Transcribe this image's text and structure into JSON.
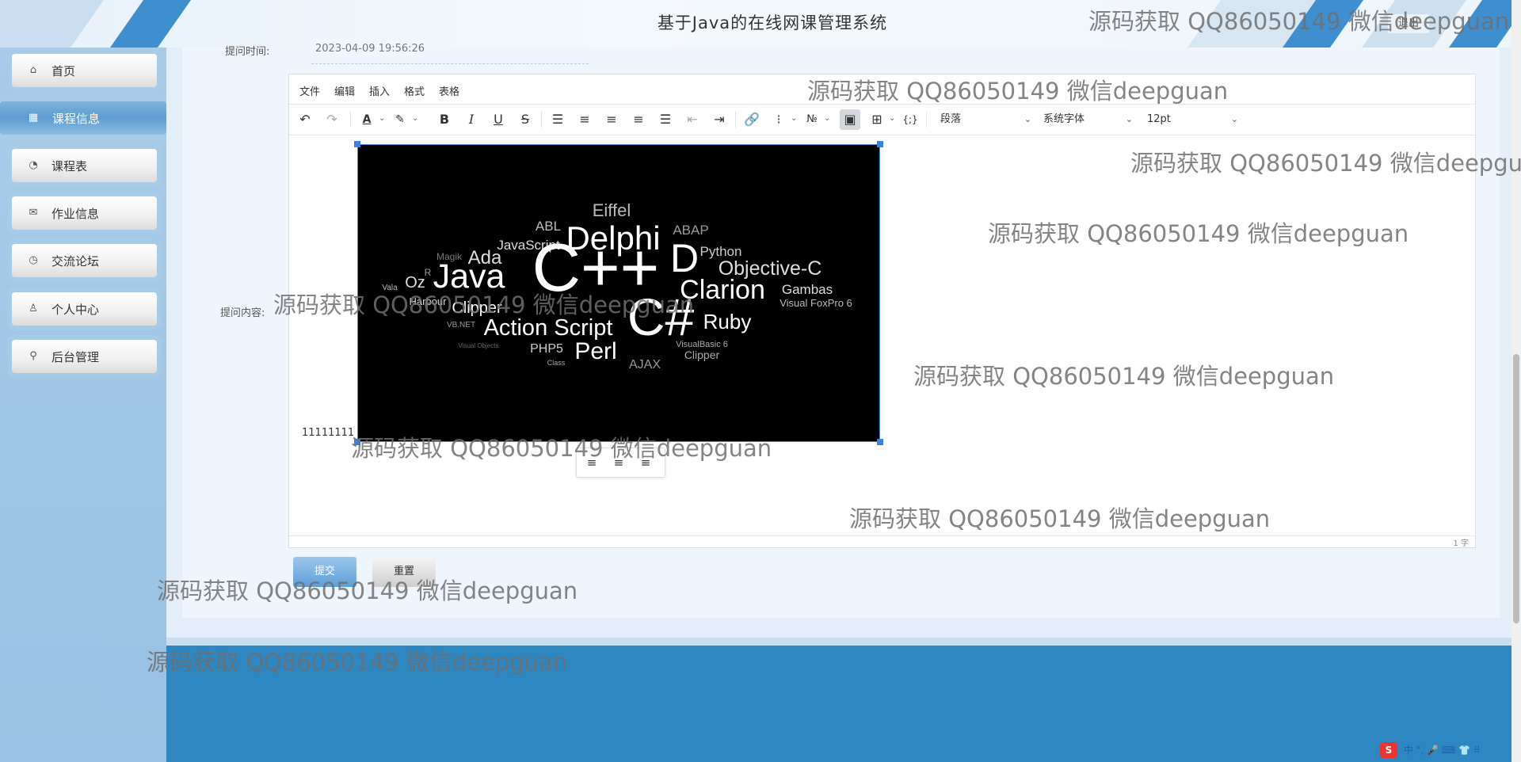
{
  "header": {
    "title": "基于Java的在线网课管理系统",
    "logout_label": "退出"
  },
  "sidebar": {
    "items": [
      {
        "label": "首页",
        "icon": "⌂"
      },
      {
        "label": "课程信息",
        "icon": "▦"
      },
      {
        "label": "课程表",
        "icon": "◔"
      },
      {
        "label": "作业信息",
        "icon": "✉"
      },
      {
        "label": "交流论坛",
        "icon": "◷"
      },
      {
        "label": "个人中心",
        "icon": "♙"
      },
      {
        "label": "后台管理",
        "icon": "⚲"
      }
    ],
    "active_index": 1
  },
  "form": {
    "time_label": "提问时间:",
    "time_value": "2023-04-09 19:56:26",
    "content_label": "提问内容:",
    "submit_label": "提交",
    "reset_label": "重置"
  },
  "editor": {
    "menu": [
      "文件",
      "编辑",
      "插入",
      "格式",
      "表格"
    ],
    "toolbar_icons": [
      "undo-icon",
      "redo-icon",
      "font-color-icon",
      "highlight-icon",
      "bold-icon",
      "italic-icon",
      "underline-icon",
      "strikethrough-icon",
      "line-height-icon",
      "align-left-icon",
      "align-center-icon",
      "align-right-icon",
      "align-justify-icon",
      "outdent-icon",
      "indent-icon",
      "link-icon",
      "bullet-list-icon",
      "numbered-list-icon",
      "image-icon",
      "table-icon",
      "code-icon"
    ],
    "block_format": "段落",
    "font_family": "系统字体",
    "font_size": "12pt",
    "content_text": "11111111",
    "word_count": "1 字",
    "image_words": [
      "Eiffel",
      "ABL",
      "Delphi",
      "ABAP",
      "JavaScript",
      "D",
      "Python",
      "Magik",
      "Ada",
      "Objective-C",
      "R",
      "Java",
      "C++",
      "Clarion",
      "Gambas",
      "Vala",
      "Oz",
      "Harbour",
      "Visual FoxPro 6",
      "Clipper",
      "Ruby",
      "VB.NET",
      "Action Script",
      "C#",
      "PHP5",
      "Perl",
      "VisualBasic 6",
      "Visual Objects",
      "Class",
      "AJAX",
      "Clipper"
    ]
  },
  "watermark_text": "源码获取 QQ86050149 微信deepguan",
  "ime": {
    "logo": "S",
    "text": "中 °, 🎤 ⌨ 👕 ⠿"
  }
}
